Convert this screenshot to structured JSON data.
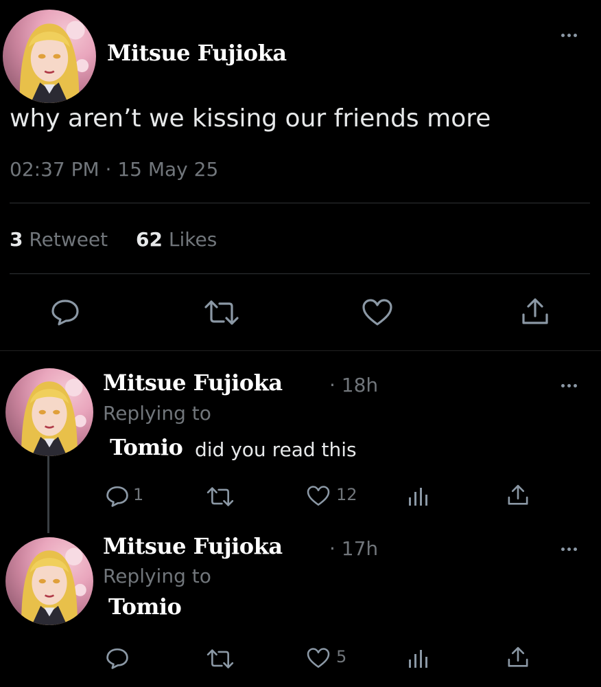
{
  "main_tweet": {
    "author": "Mitsue Fujioka",
    "text": "why aren’t we kissing our friends more",
    "timestamp": "02:37 PM · 15 May 25",
    "retweet_count": "3",
    "retweet_label": "Retweet",
    "like_count": "62",
    "like_label": "Likes",
    "action_icons": [
      "reply-icon",
      "retweet-icon",
      "like-icon",
      "share-icon"
    ]
  },
  "replies": [
    {
      "author": "Mitsue Fujioka",
      "time": "· 18h",
      "replying_label": "Replying to",
      "mention": "Tomio",
      "text": "did you read this",
      "reply_count": "1",
      "like_count": "12"
    },
    {
      "author": "Mitsue Fujioka",
      "time": "· 17h",
      "replying_label": "Replying to",
      "mention": "Tomio",
      "text": "",
      "like_count": "5"
    }
  ],
  "colors": {
    "background": "#000000",
    "text": "#e7e9ea",
    "secondary": "#71767b",
    "divider": "#2f3336"
  }
}
